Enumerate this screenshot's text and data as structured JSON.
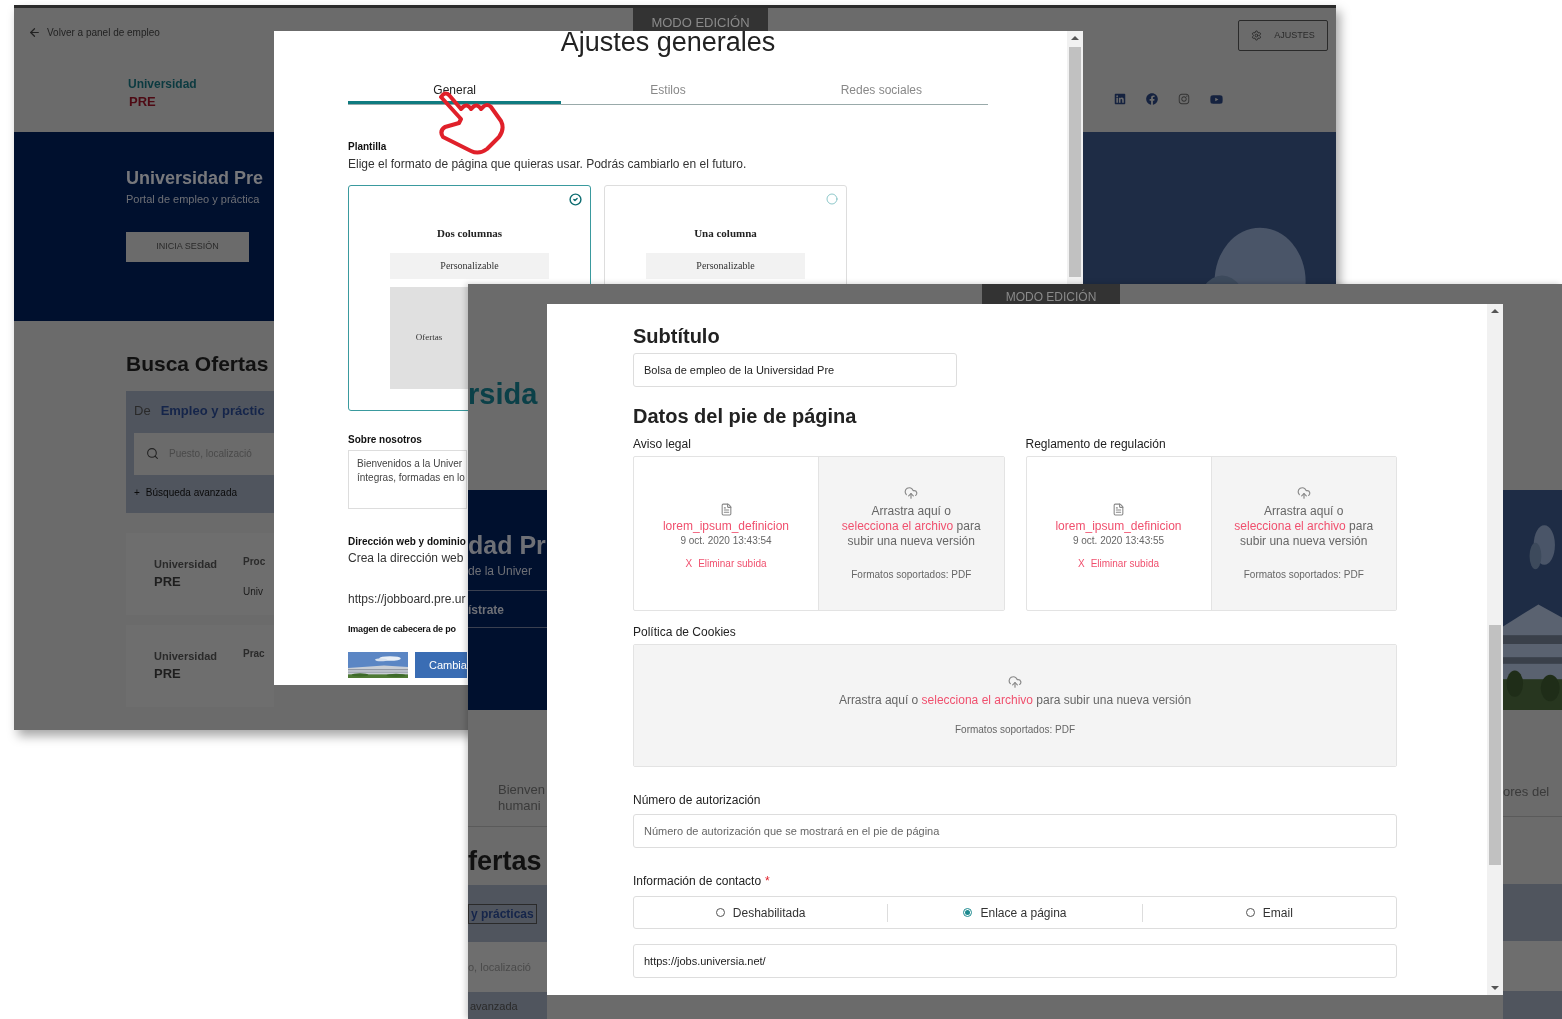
{
  "back_window": {
    "back_link": "Volver a panel de empleo",
    "edit_mode_tab": "MODO EDICIÓN",
    "settings_button": "AJUSTES",
    "logo": {
      "line_1": "Universidad",
      "line_2": "PRE"
    },
    "hero": {
      "title": "Universidad Pre",
      "subtitle": "Portal de empleo y práctica",
      "login_button": "INICIA SESIÓN"
    },
    "search": {
      "heading": "Busca Ofertas",
      "prefix": "De",
      "category": "Empleo y práctic",
      "placeholder": "Puesto, localizació",
      "advanced_icon": "+",
      "advanced": "Búsqueda avanzada"
    },
    "offer_cards": [
      {
        "logo_line_1": "Universidad",
        "logo_line_2": "PRE",
        "title": "Proc",
        "subtitle": "Univ"
      },
      {
        "logo_line_1": "Universidad",
        "logo_line_2": "PRE",
        "title": "Prac"
      }
    ],
    "dialog": {
      "title": "Ajustes generales",
      "tabs": [
        {
          "label": "General",
          "selected": true
        },
        {
          "label": "Estilos",
          "selected": false
        },
        {
          "label": "Redes sociales",
          "selected": false
        }
      ],
      "template": {
        "label": "Plantilla",
        "description": "Elige el formato de página que quieras usar. Podrás cambiarlo en el futuro.",
        "options": [
          {
            "title": "Dos columnas",
            "tag": "Personalizable",
            "preview": "Ofertas",
            "selected": true
          },
          {
            "title": "Una columna",
            "tag": "Personalizable",
            "selected": false
          }
        ]
      },
      "about": {
        "label": "Sobre nosotros",
        "lines": [
          "Bienvenidos a la Univer",
          "íntegras, formadas en lo"
        ]
      },
      "web": {
        "label": "Dirección web y dominio",
        "description": "Crea la dirección web",
        "url": "https://jobboard.pre.ur"
      },
      "header_image": {
        "label": "Imagen de cabecera de po",
        "button": "Cambia"
      }
    }
  },
  "front_window": {
    "edit_mode_tab": "MODO EDICIÓN",
    "background_left": {
      "logo_fragment": "rsida",
      "hero_title": "dad Pr",
      "hero_subtitle": "de la Univer",
      "register_link": "ístrate",
      "intro_lines": [
        "Bienven",
        "humani"
      ],
      "heading": "fertas",
      "category": "y prácticas",
      "placeholder": "o, localizació",
      "advanced": "avanzada"
    },
    "background_right": {
      "intro_fragment": "ores del"
    },
    "dialog": {
      "subtitle": {
        "heading": "Subtítulo",
        "value": "Bolsa de empleo de la Universidad Pre"
      },
      "footer_heading": "Datos del pie de página",
      "documents": [
        {
          "label": "Aviso legal",
          "file": {
            "name": "lorem_ipsum_definicion",
            "date": "9 oct. 2020 13:43:54",
            "remove_icon": "X",
            "remove": "Eliminar subida"
          },
          "drop": {
            "before": "Arrastra aquí o",
            "link": "selecciona el archivo",
            "after": "para subir una nueva versión",
            "formats": "Formatos soportados: PDF"
          }
        },
        {
          "label": "Reglamento de regulación",
          "file": {
            "name": "lorem_ipsum_definicion",
            "date": "9 oct. 2020 13:43:55",
            "remove_icon": "X",
            "remove": "Eliminar subida"
          },
          "drop": {
            "before": "Arrastra aquí o",
            "link": "selecciona el archivo",
            "after": "para subir una nueva versión",
            "formats": "Formatos soportados: PDF"
          }
        },
        {
          "label": "Política de Cookies",
          "drop": {
            "before": "Arrastra aquí o",
            "link": "selecciona el archivo",
            "after": "para subir una nueva versión",
            "formats": "Formatos soportados: PDF"
          }
        }
      ],
      "authorization": {
        "label": "Número de autorización",
        "placeholder": "Número de autorización que se mostrará en el pie de página"
      },
      "contact": {
        "label": "Información de contacto",
        "required_mark": "*",
        "options": [
          {
            "label": "Deshabilitada",
            "selected": false
          },
          {
            "label": "Enlace a página",
            "selected": true
          },
          {
            "label": "Email",
            "selected": false
          }
        ],
        "url": "https://jobs.universia.net/"
      }
    }
  }
}
